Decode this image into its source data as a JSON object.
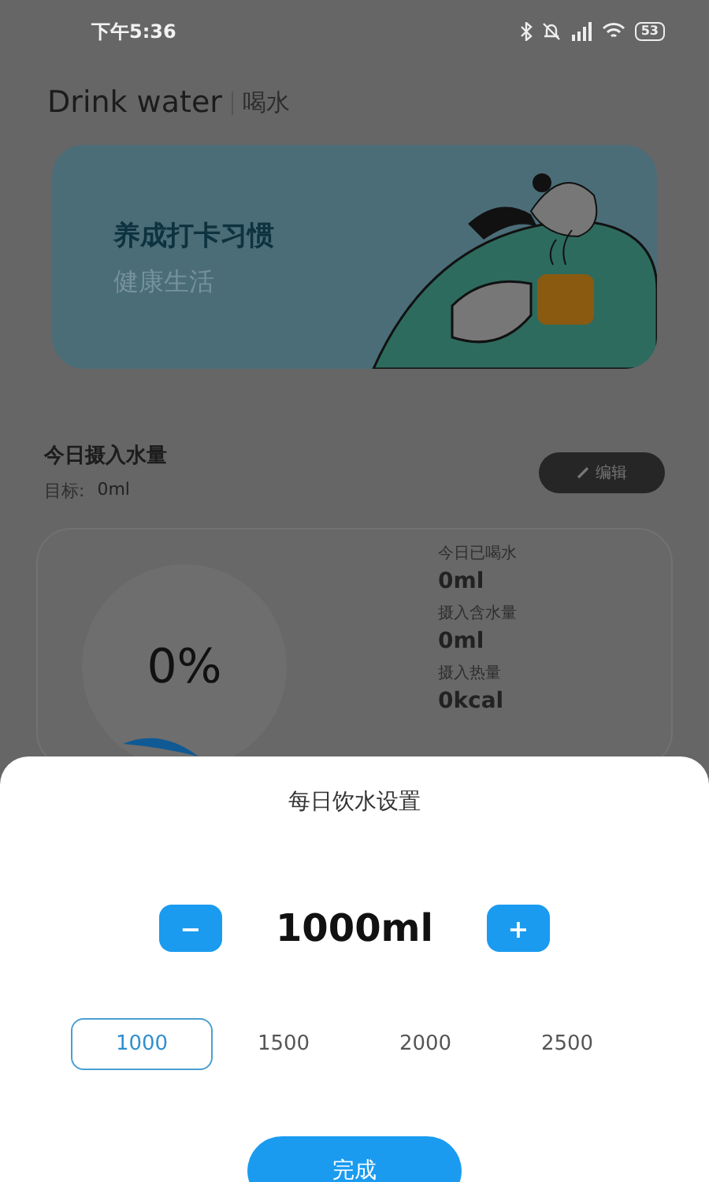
{
  "status_bar": {
    "time": "下午5:36",
    "battery": "53"
  },
  "header": {
    "title": "Drink water",
    "subtitle": "喝水"
  },
  "banner": {
    "headline": "养成打卡习惯",
    "tagline": "健康生活"
  },
  "intake": {
    "title": "今日摄入水量",
    "goal_label": "目标:",
    "goal_value": "0ml",
    "edit_button": "编辑"
  },
  "progress": {
    "percent": "0%"
  },
  "stats": [
    {
      "label": "今日已喝水",
      "value": "0ml"
    },
    {
      "label": "摄入含水量",
      "value": "0ml"
    },
    {
      "label": "摄入热量",
      "value": "0kcal"
    }
  ],
  "sheet": {
    "title": "每日饮水设置",
    "minus": "−",
    "amount": "1000ml",
    "plus": "+",
    "options": [
      {
        "label": "1000",
        "selected": true
      },
      {
        "label": "1500",
        "selected": false
      },
      {
        "label": "2000",
        "selected": false
      },
      {
        "label": "2500",
        "selected": false
      }
    ],
    "done_button": "完成"
  }
}
